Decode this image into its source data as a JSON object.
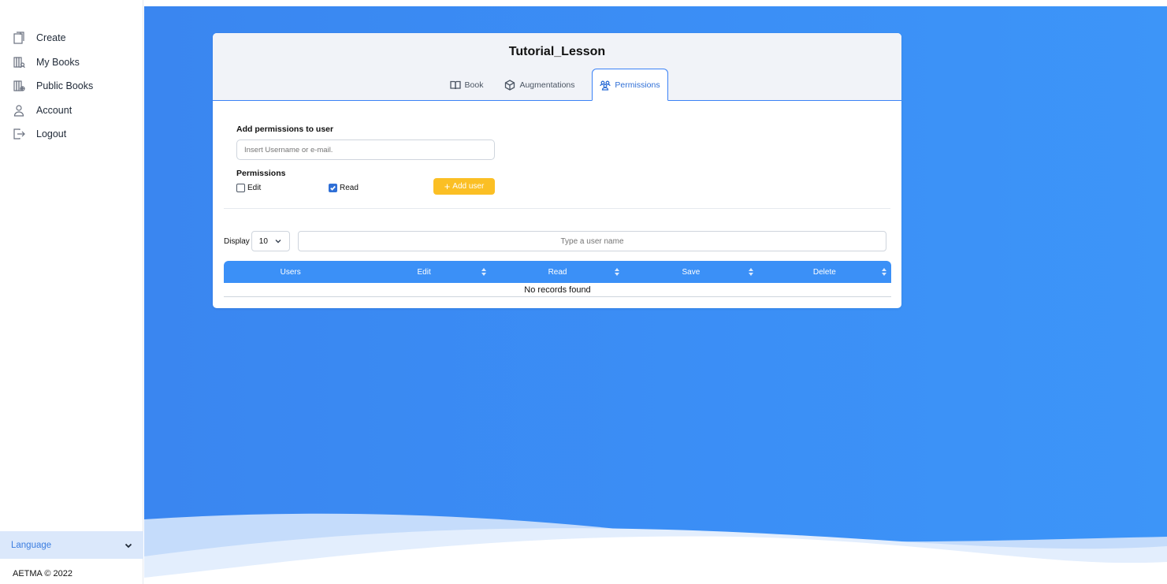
{
  "sidebar": {
    "items": [
      {
        "label": "Create",
        "icon": "create-icon"
      },
      {
        "label": "My Books",
        "icon": "my-books-icon"
      },
      {
        "label": "Public Books",
        "icon": "public-books-icon"
      },
      {
        "label": "Account",
        "icon": "account-icon"
      },
      {
        "label": "Logout",
        "icon": "logout-icon"
      }
    ],
    "language_label": "Language",
    "footer": "AETMA © 2022"
  },
  "card": {
    "title": "Tutorial_Lesson",
    "tabs": [
      {
        "label": "Book",
        "icon": "book-icon"
      },
      {
        "label": "Augmentations",
        "icon": "cube-icon"
      },
      {
        "label": "Permissions",
        "icon": "users-icon",
        "active": true
      }
    ]
  },
  "form": {
    "add_label": "Add permissions to user",
    "user_placeholder": "Insert Username or e-mail.",
    "permissions_label": "Permissions",
    "edit_label": "Edit",
    "edit_checked": false,
    "read_label": "Read",
    "read_checked": true,
    "add_button": "Add user"
  },
  "table": {
    "display_label": "Display",
    "page_size": "10",
    "search_placeholder": "Type a user name",
    "columns": [
      "Users",
      "Edit",
      "Read",
      "Save",
      "Delete"
    ],
    "empty_text": "No records found"
  },
  "colors": {
    "accent": "#3b82f6",
    "header": "#3b90f7",
    "button": "#fbbf24"
  }
}
